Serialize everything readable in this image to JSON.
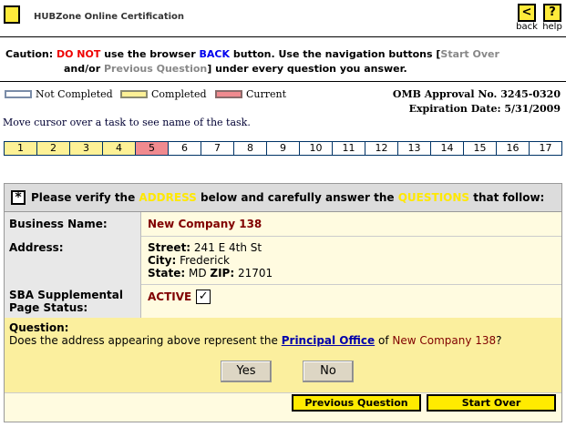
{
  "header": {
    "title": "HUBZone Online Certification",
    "back_glyph": "<",
    "back_label": "back",
    "help_glyph": "?",
    "help_label": "help"
  },
  "caution": {
    "prefix": "Caution: ",
    "do_not": "DO NOT",
    "t1": " use the browser ",
    "back": "BACK",
    "t2": " button. Use the navigation buttons [",
    "start_over": "Start Over",
    "t3": " and/or ",
    "prev_q": "Previous Question",
    "t4": "] under every question you answer."
  },
  "legend": {
    "not_completed": "Not Completed",
    "completed": "Completed",
    "current": "Current",
    "colors": {
      "not_completed": "#ffffff",
      "completed": "#fdf196",
      "current": "#f08a8f"
    }
  },
  "omb": {
    "approval": "OMB Approval No. 3245-0320",
    "expiration": "Expiration Date: 5/31/2009"
  },
  "hint": "Move cursor over a task to see name of the task.",
  "tasks": [
    {
      "n": "1",
      "state": "done"
    },
    {
      "n": "2",
      "state": "done"
    },
    {
      "n": "3",
      "state": "done"
    },
    {
      "n": "4",
      "state": "done"
    },
    {
      "n": "5",
      "state": "cur"
    },
    {
      "n": "6",
      "state": "todo"
    },
    {
      "n": "7",
      "state": "todo"
    },
    {
      "n": "8",
      "state": "todo"
    },
    {
      "n": "9",
      "state": "todo"
    },
    {
      "n": "10",
      "state": "todo"
    },
    {
      "n": "11",
      "state": "todo"
    },
    {
      "n": "12",
      "state": "todo"
    },
    {
      "n": "13",
      "state": "todo"
    },
    {
      "n": "14",
      "state": "todo"
    },
    {
      "n": "15",
      "state": "todo"
    },
    {
      "n": "16",
      "state": "todo"
    },
    {
      "n": "17",
      "state": "todo"
    }
  ],
  "form": {
    "star": "*",
    "h1": "Please verify the ",
    "address_word": "ADDRESS",
    "h2": " below and  carefully answer the ",
    "questions_word": "QUESTIONS",
    "h3": " that follow:",
    "business_label": "Business Name:",
    "business_value": "New Company 138",
    "address_label": "Address:",
    "street_label": "Street:",
    "street_value": " 241 E 4th St",
    "city_label": "City:",
    "city_value": " Frederick",
    "state_label": "State:",
    "state_value": " MD ",
    "zip_label": "ZIP:",
    "zip_value": " 21701",
    "sba_label_1": "SBA Supplemental",
    "sba_label_2": "Page Status:",
    "sba_value": "ACTIVE",
    "sba_checked": true
  },
  "question": {
    "label": "Question:",
    "t1": "Does the address appearing above represent the ",
    "link": "Principal Office",
    "t2": " of ",
    "company": "New Company 138",
    "t3": "?",
    "yes": "Yes",
    "no": "No"
  },
  "nav": {
    "previous": "Previous Question",
    "start_over": "Start Over"
  }
}
